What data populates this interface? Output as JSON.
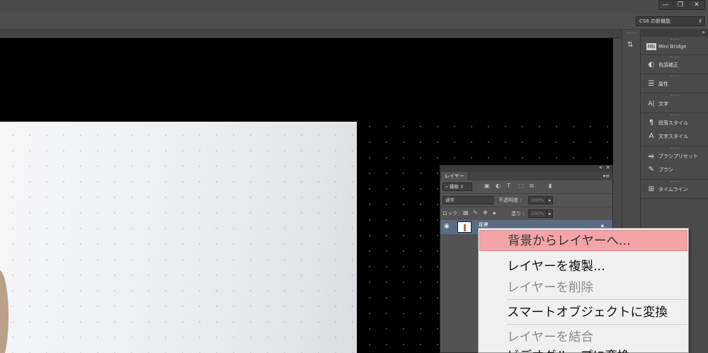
{
  "window": {
    "minimize": "—",
    "restore": "❐",
    "close": "✕"
  },
  "options_bar": {
    "workspace": "CS6 の新機能"
  },
  "dock": {
    "items": [
      {
        "icon": "mini-bridge-icon",
        "glyph": "Mb",
        "label": "Mini Bridge"
      },
      {
        "icon": "adjustments-icon",
        "glyph": "◐",
        "label": "色調補正"
      },
      {
        "icon": "properties-icon",
        "glyph": "☰",
        "label": "属性"
      },
      {
        "icon": "character-icon",
        "glyph": "A|",
        "label": "文字"
      },
      {
        "icon": "paragraph-styles-icon",
        "glyph": "¶",
        "label": "段落スタイル"
      },
      {
        "icon": "character-styles-icon",
        "glyph": "A",
        "label": "文字スタイル"
      },
      {
        "icon": "brush-presets-icon",
        "glyph": "⥤",
        "label": "ブラシプリセット"
      },
      {
        "icon": "brush-icon",
        "glyph": "✎",
        "label": "ブラシ"
      },
      {
        "icon": "timeline-icon",
        "glyph": "⊞",
        "label": "タイムライン"
      }
    ]
  },
  "layers_panel": {
    "tab": "レイヤー",
    "filter_kind": "種類",
    "blend_mode": "通常",
    "opacity_label": "不透明度 :",
    "opacity_value": "100%",
    "lock_label": "ロック :",
    "fill_label": "塗り :",
    "fill_value": "100%",
    "layer_name": "背景"
  },
  "context_menu": {
    "items": [
      {
        "label": "背景からレイヤーへ...",
        "state": "highlighted"
      },
      {
        "label": "レイヤーを複製...",
        "state": "enabled"
      },
      {
        "label": "レイヤーを削除",
        "state": "disabled"
      },
      {
        "label": "スマートオブジェクトに変換",
        "state": "enabled"
      },
      {
        "label": "レイヤーを結合",
        "state": "disabled"
      },
      {
        "label": "ビデオグループに変換",
        "state": "enabled"
      }
    ]
  },
  "colors": {
    "highlight": "#f4a4a6",
    "selected_layer": "#5a6c84",
    "ui_dark": "#535353"
  }
}
